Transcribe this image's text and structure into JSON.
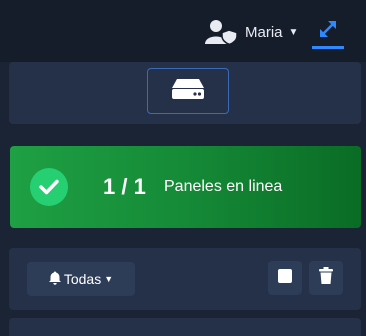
{
  "header": {
    "user_name": "Maria",
    "user_icon": "user-shield-icon",
    "expand_icon": "expand-arrows-icon"
  },
  "server": {
    "icon": "server-drive-icon"
  },
  "status": {
    "count": "1 / 1",
    "label": "Paneles en linea",
    "icon": "check-circle-icon",
    "colors": {
      "start": "#1fa044",
      "end": "#0a6c25",
      "circle": "#27cf73"
    }
  },
  "alerts": {
    "filter_label": "Todas",
    "bell_icon": "bell-icon",
    "stop_icon": "square-icon",
    "trash_icon": "trash-icon"
  },
  "accent_color": "#2f88ff"
}
